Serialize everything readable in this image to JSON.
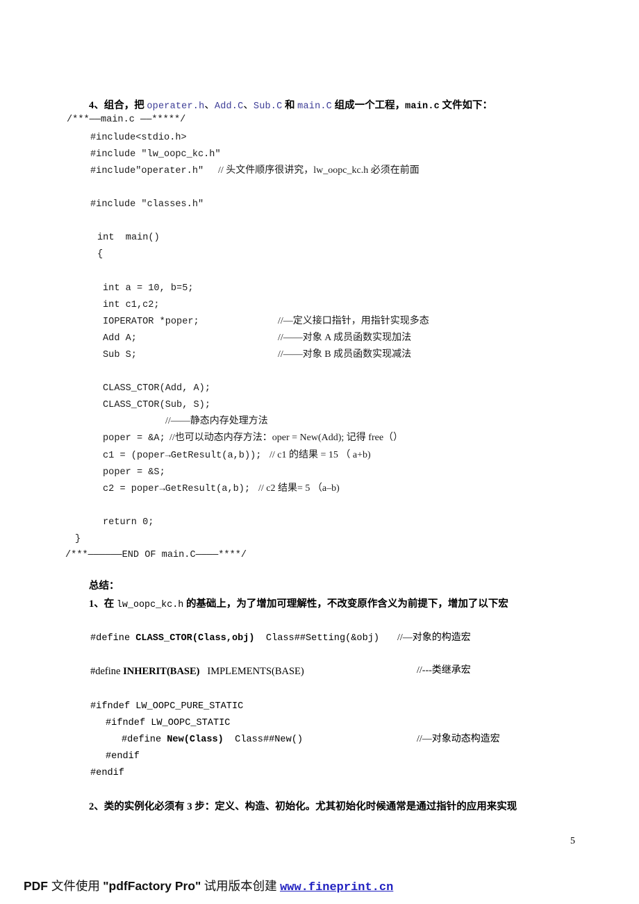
{
  "document": {
    "page_number": "5"
  },
  "heading": {
    "index": "4、",
    "label_1": "组合，把 ",
    "file_1": "operater.h",
    "sep_1": "、",
    "file_2": "Add.C",
    "sep_2": "、",
    "file_3": "Sub.C",
    "sep_3": " 和 ",
    "file_4": "main.C",
    "label_2": " 组成一个工程，",
    "file_5": "main.c",
    "label_3": " 文件如下："
  },
  "code": {
    "banner_open": "/***——main.c ——*****/",
    "banner_close": "/***——————END OF main.C————****/",
    "lines": [
      {
        "text": "#include<stdio.h>",
        "comment": ""
      },
      {
        "text": "#include \"lw_oopc_kc.h\"",
        "comment": ""
      },
      {
        "text": "#include\"operater.h\"",
        "comment": "// 头文件顺序很讲究，lw_oopc_kc.h 必须在前面"
      },
      {
        "text": "#include \"classes.h\"",
        "comment": ""
      },
      {
        "text": "int  main()",
        "comment": ""
      },
      {
        "text": "{",
        "comment": ""
      },
      {
        "text": "int a = 10, b=5;",
        "comment": ""
      },
      {
        "text": "int c1,c2;",
        "comment": ""
      },
      {
        "text": "IOPERATOR *poper;",
        "comment": "//—定义接口指针，用指针实现多态"
      },
      {
        "text": "Add A;",
        "comment": "//——对象 A 成员函数实现加法"
      },
      {
        "text": "Sub S;",
        "comment": "//——对象 B 成员函数实现减法"
      },
      {
        "text": "CLASS_CTOR(Add, A);",
        "comment": ""
      },
      {
        "text": "CLASS_CTOR(Sub, S);",
        "comment": ""
      },
      {
        "text": "",
        "comment": "//——静态内存处理方法"
      },
      {
        "text": "poper = &A;",
        "comment": "//也可以动态内存方法：oper = New(Add); 记得 free（）"
      },
      {
        "text": "c1 = (poper→GetResult(a,b));",
        "comment": "// c1 的结果 = 15 （ a+b)"
      },
      {
        "text": "poper = &S;",
        "comment": ""
      },
      {
        "text": "c2 = poper→GetResult(a,b);",
        "comment": "// c2 结果= 5 （a–b)"
      },
      {
        "text": "return 0;",
        "comment": ""
      },
      {
        "text": "}",
        "comment": ""
      }
    ]
  },
  "summary": {
    "title": "总结：",
    "point_1_a": "1、在 ",
    "point_1_code": "lw_oopc_kc.h",
    "point_1_b": " 的基础上，为了增加可理解性，不改变原作含义为前提下，增加了以下宏",
    "point_2": "2、类的实例化必须有 3 步：定义、构造、初始化。尤其初始化时候通常是通过指针的应用来实现"
  },
  "macros": {
    "class_ctor": {
      "keyword": "#define ",
      "name": "CLASS_CTOR(Class,obj)",
      "body": "Class##Setting(&obj)",
      "comment": "//—对象的构造宏"
    },
    "inherit": {
      "keyword": "#define ",
      "name": "INHERIT(BASE)",
      "body": "IMPLEMENTS(BASE)",
      "comment": "//---类继承宏"
    },
    "ifndef_outer": "#ifndef LW_OOPC_PURE_STATIC",
    "ifndef_inner": "#ifndef LW_OOPC_STATIC",
    "new_macro": {
      "keyword": "#define ",
      "name": "New(Class)",
      "body": "Class##New()",
      "comment": "//—对象动态构造宏"
    },
    "endif_inner": "#endif",
    "endif_outer": "#endif"
  },
  "footer": {
    "prefix": "PDF ",
    "cn_1": "文件使用 ",
    "product": "\"pdfFactory Pro\"",
    "cn_2": " 试用版本创建 ",
    "url": "www.fineprint.cn"
  },
  "colors": {
    "comment_blue": "#3c3c96",
    "link_blue": "#2020c0",
    "text": "#000000"
  }
}
